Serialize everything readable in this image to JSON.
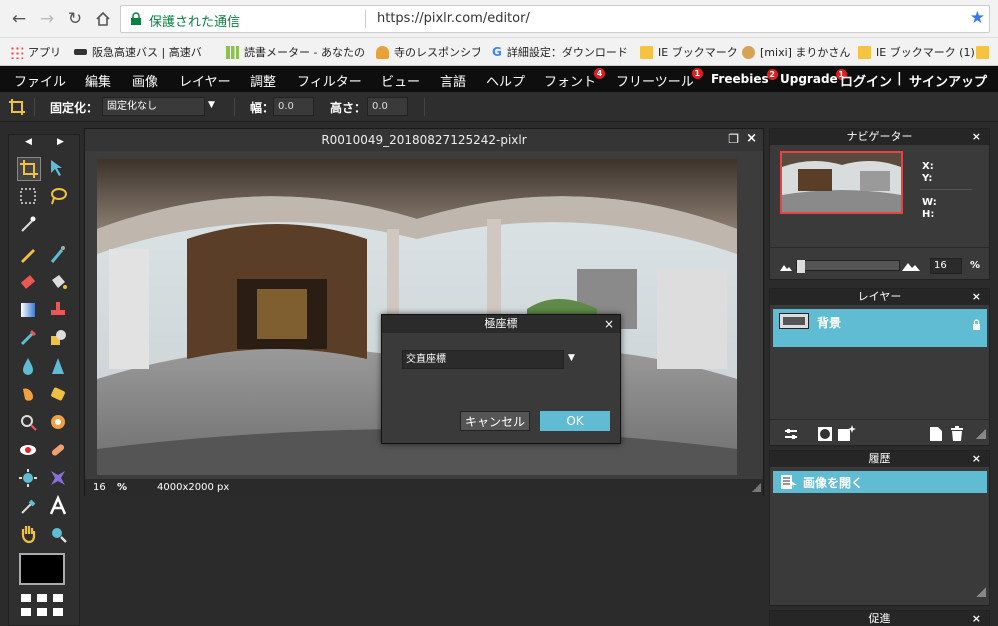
{
  "browser": {
    "secure_label": "保護された通信",
    "url": "https://pixlr.com/editor/",
    "bookmarks": [
      {
        "label": "アプリ",
        "icon": "apps-grid-icon"
      },
      {
        "label": "阪急高速バス | 高速バ",
        "icon": "bus-icon"
      },
      {
        "label": "読書メーター - あなたの読",
        "icon": "chart-bars-icon"
      },
      {
        "label": "寺のレスポンシブ",
        "icon": "temple-icon"
      },
      {
        "label": "詳細設定：ダウンロード",
        "icon": "google-icon"
      },
      {
        "label": "IE ブックマーク",
        "icon": "folder-icon"
      },
      {
        "label": "[mixi] まりかさん",
        "icon": "mixi-icon"
      },
      {
        "label": "IE ブックマーク (1)",
        "icon": "folder-icon"
      }
    ]
  },
  "menu": {
    "items": [
      "ファイル",
      "編集",
      "画像",
      "レイヤー",
      "調整",
      "フィルター",
      "ビュー",
      "言語",
      "ヘルプ"
    ],
    "font": "フォント",
    "font_badge": "4",
    "freetool": "フリーツール",
    "freetool_badge": "1",
    "freebies": "Freebies",
    "freebies_badge": "2",
    "upgrade": "Upgrade",
    "upgrade_badge": "1",
    "login": "ログイン",
    "divider": "|",
    "signup": "サインアップ"
  },
  "options": {
    "fix_label": "固定化：",
    "fix_value": "固定化なし",
    "width_label": "幅：",
    "width_value": "0.0",
    "height_label": "高さ：",
    "height_value": "0.0"
  },
  "canvas": {
    "title": "R0010049_20180827125242-pixlr",
    "zoom": "16",
    "zoom_unit": "%",
    "size": "4000x2000 px"
  },
  "dialog": {
    "title": "極座標",
    "option": "交直座標",
    "cancel": "キャンセル",
    "ok": "OK"
  },
  "navigator": {
    "title": "ナビゲーター",
    "x": "X:",
    "y": "Y:",
    "w": "W:",
    "h": "H:",
    "zoom": "16",
    "zoom_unit": "%"
  },
  "layers": {
    "title": "レイヤー",
    "layer_name": "背景"
  },
  "history": {
    "title": "履歴",
    "item": "画像を開く"
  },
  "promo": {
    "title": "促進"
  },
  "colors": {
    "accent": "#5fbcd3",
    "menubar": "#0e0e0e",
    "badge": "#e21d1d"
  }
}
